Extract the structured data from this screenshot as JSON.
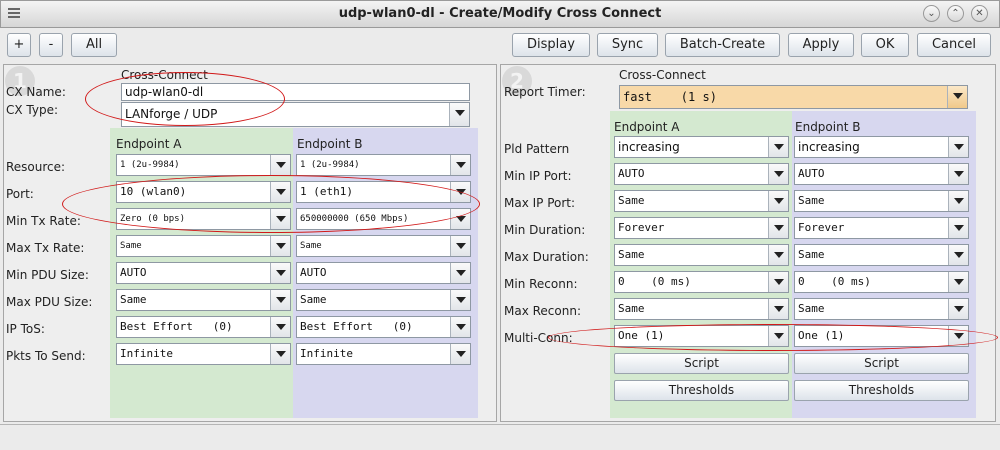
{
  "window": {
    "title": "udp-wlan0-dl - Create/Modify Cross Connect"
  },
  "toolbar": {
    "plus": "+",
    "minus": "-",
    "all": "All",
    "display": "Display",
    "sync": "Sync",
    "batch_create": "Batch-Create",
    "apply": "Apply",
    "ok": "OK",
    "cancel": "Cancel"
  },
  "left": {
    "panel_number": "1",
    "cross_connect_header": "Cross-Connect",
    "cx_name_label": "CX Name:",
    "cx_name_value": "udp-wlan0-dl",
    "cx_type_label": "CX Type:",
    "cx_type_value": "LANforge / UDP",
    "endpoint_a_header": "Endpoint A",
    "endpoint_b_header": "Endpoint B",
    "rows": [
      {
        "label": "Resource:",
        "a": "1 (2u-9984)",
        "b": "1 (2u-9984)"
      },
      {
        "label": "Port:",
        "a": "10 (wlan0)",
        "b": "1 (eth1)"
      },
      {
        "label": "Min Tx Rate:",
        "a": "Zero (0 bps)",
        "b": "650000000 (650 Mbps)"
      },
      {
        "label": "Max Tx Rate:",
        "a": "Same",
        "b": "Same"
      },
      {
        "label": "Min PDU Size:",
        "a": "AUTO",
        "b": "AUTO"
      },
      {
        "label": "Max PDU Size:",
        "a": "Same",
        "b": "Same"
      },
      {
        "label": "IP ToS:",
        "a": "Best Effort   (0)",
        "b": "Best Effort   (0)"
      },
      {
        "label": "Pkts To Send:",
        "a": "Infinite",
        "b": "Infinite"
      }
    ]
  },
  "right": {
    "panel_number": "2",
    "cross_connect_header": "Cross-Connect",
    "report_timer_label": "Report Timer:",
    "report_timer_value": "fast    (1 s)",
    "endpoint_a_header": "Endpoint A",
    "endpoint_b_header": "Endpoint B",
    "rows": [
      {
        "label": "Pld Pattern",
        "a": "increasing",
        "b": "increasing"
      },
      {
        "label": "Min IP Port:",
        "a": "AUTO",
        "b": "AUTO"
      },
      {
        "label": "Max IP Port:",
        "a": "Same",
        "b": "Same"
      },
      {
        "label": "Min Duration:",
        "a": "Forever",
        "b": "Forever"
      },
      {
        "label": "Max Duration:",
        "a": "Same",
        "b": "Same"
      },
      {
        "label": "Min Reconn:",
        "a": "0    (0 ms)",
        "b": "0    (0 ms)"
      },
      {
        "label": "Max Reconn:",
        "a": "Same",
        "b": "Same"
      },
      {
        "label": "Multi-Conn:",
        "a": "One (1)",
        "b": "One (1)"
      }
    ],
    "script_label": "Script",
    "thresholds_label": "Thresholds"
  },
  "colors": {
    "endpoint_a_bg": "#d4e9d0",
    "endpoint_b_bg": "#d7d7ef",
    "report_timer_bg": "#f8d9a8",
    "annotation": "#d11a1a"
  }
}
